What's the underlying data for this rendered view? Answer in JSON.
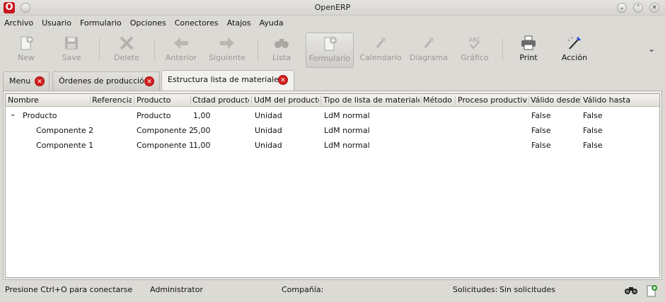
{
  "window": {
    "title": "OpenERP",
    "app_icon_letter": "O"
  },
  "menubar": {
    "items": [
      "Archivo",
      "Usuario",
      "Formulario",
      "Opciones",
      "Conectores",
      "Atajos",
      "Ayuda"
    ]
  },
  "toolbar": {
    "new": "New",
    "save": "Save",
    "delete": "Delete",
    "previous": "Anterior",
    "next": "Siguiente",
    "list": "Lista",
    "form": "Formulario",
    "calendar": "Calendario",
    "diagram": "Diagrama",
    "graph": "Gráfico",
    "print": "Print",
    "action": "Acción",
    "graph_icon_text": "ABC"
  },
  "tabs": [
    {
      "label": "Menu"
    },
    {
      "label": "Órdenes de producción"
    },
    {
      "label": "Estructura lista de materiales"
    }
  ],
  "grid": {
    "columns": [
      "Nombre",
      "Referencia",
      "Producto",
      "Ctdad producto",
      "UdM del producto",
      "Tipo de lista de materiales",
      "Método",
      "Proceso productivo",
      "Válido desde",
      "Válido hasta"
    ],
    "rows": [
      {
        "nombre": "Producto",
        "referencia": "",
        "producto": "Producto",
        "cantidad": "1,00",
        "udm": "Unidad",
        "tipo": "LdM normal",
        "metodo": "",
        "proceso": "",
        "desde": "False",
        "hasta": "False"
      },
      {
        "nombre": "Componente 2",
        "referencia": "",
        "producto": "Componente 2",
        "cantidad": "5,00",
        "udm": "Unidad",
        "tipo": "LdM normal",
        "metodo": "",
        "proceso": "",
        "desde": "False",
        "hasta": "False"
      },
      {
        "nombre": "Componente 1",
        "referencia": "",
        "producto": "Componente 1",
        "cantidad": "1,00",
        "udm": "Unidad",
        "tipo": "LdM normal",
        "metodo": "",
        "proceso": "",
        "desde": "False",
        "hasta": "False"
      }
    ]
  },
  "statusbar": {
    "connect_hint": "Presione Ctrl+O para conectarse",
    "user": "Administrator",
    "company_label": "Compañía:",
    "requests_label": "Solicitudes:",
    "requests_value": "Sin solicitudes"
  },
  "colors": {
    "close_red": "#d41f1f",
    "brand_red": "#c8141c"
  }
}
